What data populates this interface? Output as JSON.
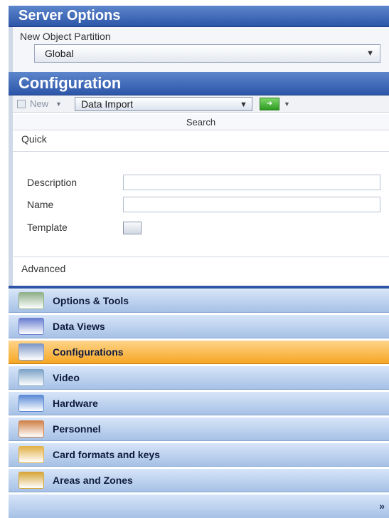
{
  "server_options": {
    "title": "Server Options",
    "label": "New Object Partition",
    "selected": "Global"
  },
  "configuration": {
    "title": "Configuration",
    "toolbar": {
      "new_label": "New",
      "type_selected": "Data Import"
    },
    "search_label": "Search",
    "quick_label": "Quick",
    "fields": {
      "description_label": "Description",
      "name_label": "Name",
      "template_label": "Template"
    },
    "advanced_label": "Advanced"
  },
  "nav": {
    "items": [
      {
        "label": "Options & Tools",
        "icon": "tools-icon",
        "color": "#8fb08a"
      },
      {
        "label": "Data Views",
        "icon": "data-views-icon",
        "color": "#6a7fd0"
      },
      {
        "label": "Configurations",
        "icon": "configuration-icon",
        "color": "#7f98c8",
        "selected": true
      },
      {
        "label": "Video",
        "icon": "video-camera-icon",
        "color": "#7fa4c8"
      },
      {
        "label": "Hardware",
        "icon": "hardware-icon",
        "color": "#5a8ad6"
      },
      {
        "label": "Personnel",
        "icon": "personnel-icon",
        "color": "#d0834a"
      },
      {
        "label": "Card formats and keys",
        "icon": "card-formats-icon",
        "color": "#e2b24a"
      },
      {
        "label": "Areas and Zones",
        "icon": "areas-icon",
        "color": "#d6a63a"
      }
    ],
    "selected_color": "#f5a623"
  }
}
